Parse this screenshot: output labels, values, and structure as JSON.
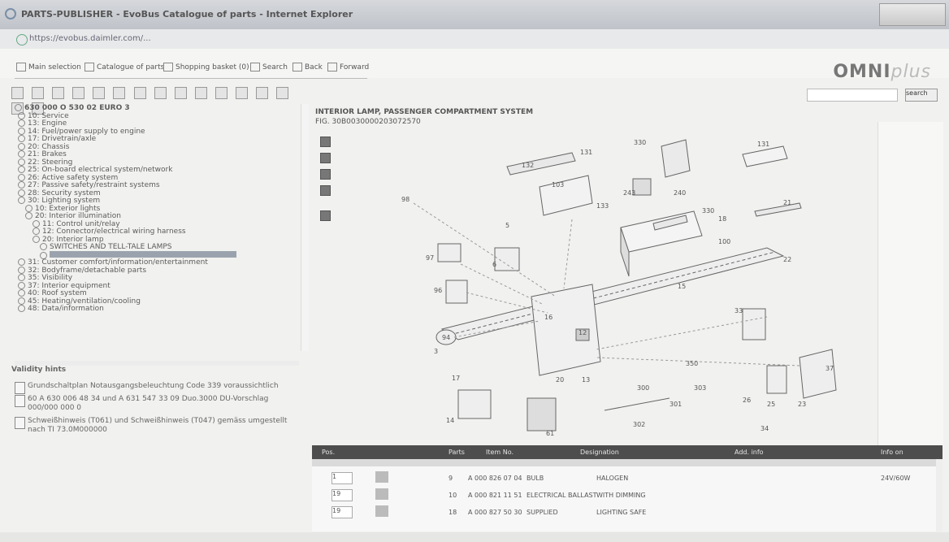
{
  "window": {
    "title": "PARTS-PUBLISHER - EvoBus Catalogue of parts - Internet Explorer",
    "url": "https://evobus.daimler.com/..."
  },
  "menu": [
    {
      "label": "Main selection",
      "icon": "home-icon"
    },
    {
      "label": "Catalogue of parts",
      "icon": "book-icon"
    },
    {
      "label": "Shopping basket (0)",
      "icon": "cart-icon"
    },
    {
      "label": "Search",
      "icon": "search-icon"
    },
    {
      "label": "Back",
      "icon": "back-arrow-icon"
    },
    {
      "label": "Forward",
      "icon": "forward-arrow-icon"
    }
  ],
  "brand": {
    "logo_main": "OMNI",
    "logo_plus": "plus"
  },
  "search": {
    "placeholder": "",
    "select_value": "search"
  },
  "tree": {
    "root": "630 000 O 530 02 EURO 3",
    "nodes": [
      {
        "label": "10: Service",
        "level": 1
      },
      {
        "label": "13: Engine",
        "level": 1
      },
      {
        "label": "14: Fuel/power supply to engine",
        "level": 1
      },
      {
        "label": "17: Drivetrain/axle",
        "level": 1
      },
      {
        "label": "20: Chassis",
        "level": 1
      },
      {
        "label": "21: Brakes",
        "level": 1
      },
      {
        "label": "22: Steering",
        "level": 1
      },
      {
        "label": "25: On-board electrical system/network",
        "level": 1
      },
      {
        "label": "26: Active safety system",
        "level": 1
      },
      {
        "label": "27: Passive safety/restraint systems",
        "level": 1
      },
      {
        "label": "28: Security system",
        "level": 1
      },
      {
        "label": "30: Lighting system",
        "level": 1
      },
      {
        "label": "10: Exterior lights",
        "level": 2
      },
      {
        "label": "20: Interior illumination",
        "level": 2
      },
      {
        "label": "11: Control unit/relay",
        "level": 3
      },
      {
        "label": "12: Connector/electrical wiring harness",
        "level": 3
      },
      {
        "label": "20: Interior lamp",
        "level": 3
      },
      {
        "label": "SWITCHES AND TELL-TALE LAMPS",
        "level": 4
      },
      {
        "label": "",
        "level": 4,
        "selected": true
      },
      {
        "label": "31: Customer comfort/information/entertainment",
        "level": 1
      },
      {
        "label": "32: Bodyframe/detachable parts",
        "level": 1
      },
      {
        "label": "35: Visibility",
        "level": 1
      },
      {
        "label": "37: Interior equipment",
        "level": 1
      },
      {
        "label": "40: Roof system",
        "level": 1
      },
      {
        "label": "45: Heating/ventilation/cooling",
        "level": 1
      },
      {
        "label": "48: Data/information",
        "level": 1
      }
    ]
  },
  "validity": {
    "heading": "Validity hints",
    "items": [
      {
        "text": "Grundschaltplan Notausgangsbeleuchtung Code 339 voraussichtlich"
      },
      {
        "text": "60 A 630 006 48 34 und A 631 547 33 09 Duo.3000 DU-Vorschlag 000/000 000 0"
      },
      {
        "text": "Schweißhinweis (T061) und Schweißhinweis (T047) gemäss umgestellt nach TI 73.0M000000"
      }
    ]
  },
  "diagram": {
    "title": "INTERIOR LAMP, PASSENGER COMPARTMENT SYSTEM",
    "code": "FIG. 30B0030000203072570",
    "labels": [
      "132",
      "131",
      "130",
      "103",
      "133",
      "330",
      "240",
      "243",
      "131",
      "98",
      "5",
      "6",
      "8",
      "97",
      "96",
      "94",
      "3",
      "17",
      "14",
      "16",
      "12",
      "13",
      "15",
      "35",
      "350",
      "301",
      "302",
      "80",
      "61",
      "20",
      "303",
      "39",
      "33",
      "37",
      "26",
      "25",
      "23",
      "34",
      "22",
      "21",
      "100",
      "18"
    ]
  },
  "grid": {
    "columns": [
      "Pos.",
      "",
      "Parts",
      "Item No.",
      "Designation",
      "",
      "Add. info",
      "Info on"
    ],
    "rows": [
      {
        "qty": "1",
        "pos": "9",
        "partno": "A 000 826 07 04",
        "designation": "BULB",
        "addinfo": "HALOGEN",
        "info": "24V/60W",
        "selected": false
      },
      {
        "qty": "19",
        "pos": "10",
        "partno": "A 000 821 11 51",
        "designation": "ELECTRICAL BALLAST",
        "addinfo": "WITH DIMMING",
        "info": "",
        "selected": false
      },
      {
        "qty": "19",
        "pos": "18",
        "partno": "A 000 827 50 30",
        "designation": "SUPPLIED",
        "addinfo": "LIGHTING SAFE",
        "info": "",
        "selected": false
      }
    ]
  },
  "colors": {
    "accent": "#4d4d4d",
    "selected": "#9aa3ad"
  }
}
